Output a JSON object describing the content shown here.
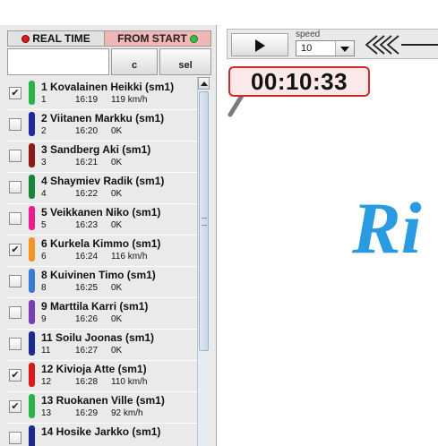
{
  "modes": {
    "real_time": "REAL TIME",
    "from_start": "FROM START"
  },
  "controls": {
    "search_value": "",
    "c_label": "c",
    "sel_label": "sel"
  },
  "playback": {
    "speed_label": "speed",
    "speed_value": "10",
    "elapsed": "00:10:33"
  },
  "competitors": [
    {
      "name": "1 Kovalainen Heikki (sm1)",
      "num": "1",
      "time": "16:19",
      "speed": "119 km/h",
      "color": "#2db24a",
      "checked": true
    },
    {
      "name": "2 Viitanen Markku (sm1)",
      "num": "2",
      "time": "16:20",
      "speed": "0K",
      "color": "#1f2a9a",
      "checked": false
    },
    {
      "name": "3 Sandberg Aki (sm1)",
      "num": "3",
      "time": "16:21",
      "speed": "0K",
      "color": "#8b1a1a",
      "checked": false
    },
    {
      "name": "4 Shaymiev Radik (sm1)",
      "num": "4",
      "time": "16:22",
      "speed": "0K",
      "color": "#17853a",
      "checked": false
    },
    {
      "name": "5 Veikkanen Niko (sm1)",
      "num": "5",
      "time": "16:23",
      "speed": "0K",
      "color": "#e91e8c",
      "checked": false
    },
    {
      "name": "6 Kurkela Kimmo (sm1)",
      "num": "6",
      "time": "16:24",
      "speed": "116 km/h",
      "color": "#f39325",
      "checked": true
    },
    {
      "name": "8 Kuivinen Timo (sm1)",
      "num": "8",
      "time": "16:25",
      "speed": "0K",
      "color": "#3a7bd5",
      "checked": false
    },
    {
      "name": "9 Marttila Karri (sm1)",
      "num": "9",
      "time": "16:26",
      "speed": "0K",
      "color": "#7a3fb0",
      "checked": false
    },
    {
      "name": "11 Soilu Joonas (sm1)",
      "num": "11",
      "time": "16:27",
      "speed": "0K",
      "color": "#1b2a8c",
      "checked": false
    },
    {
      "name": "12 Kivioja Atte (sm1)",
      "num": "12",
      "time": "16:28",
      "speed": "110 km/h",
      "color": "#d81b1b",
      "checked": true
    },
    {
      "name": "13 Ruokanen Ville (sm1)",
      "num": "13",
      "time": "16:29",
      "speed": "92 km/h",
      "color": "#2db24a",
      "checked": true
    },
    {
      "name": "14 Hosike Jarkko (sm1)",
      "num": "",
      "time": "",
      "speed": "",
      "color": "#1b2a8c",
      "checked": false
    }
  ],
  "map": {
    "logo_text": "Ri",
    "logo_color": "#2a9be0",
    "track_color": "#7a7a7a"
  }
}
